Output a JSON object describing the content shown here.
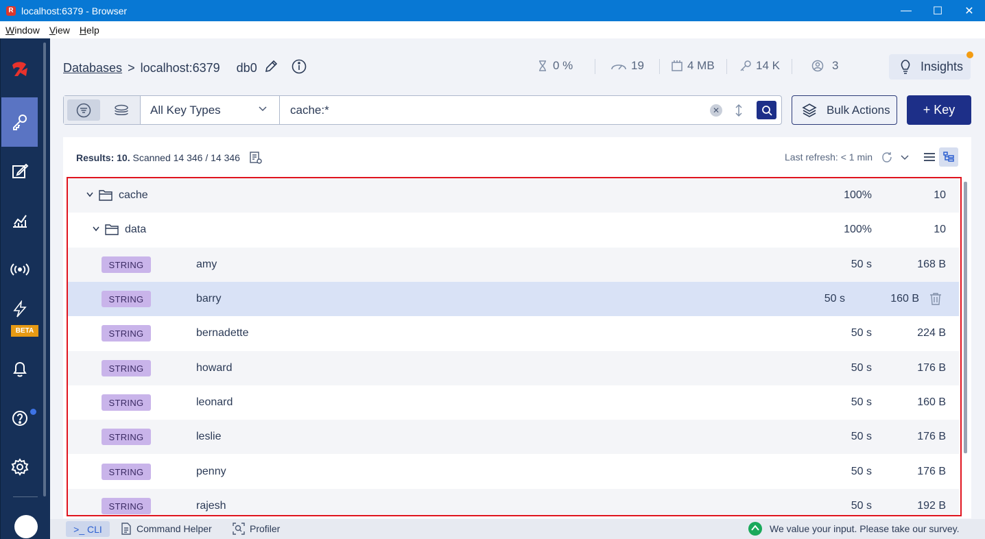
{
  "window": {
    "title": "localhost:6379 - Browser",
    "app_icon": "R"
  },
  "menu": [
    "Window",
    "View",
    "Help"
  ],
  "sidebar": {
    "beta_label": "BETA"
  },
  "breadcrumb": {
    "databases": "Databases",
    "separator": ">",
    "host": "localhost:6379",
    "db": "db0"
  },
  "stats": {
    "cpu": "0 %",
    "ops": "19",
    "memory": "4 MB",
    "keys": "14 K",
    "clients": "3"
  },
  "insights_label": "Insights",
  "filter": {
    "key_type": "All Key Types",
    "search_value": "cache:*"
  },
  "buttons": {
    "bulk_actions": "Bulk Actions",
    "add_key": "+ Key"
  },
  "results": {
    "label": "Results:",
    "count": "10.",
    "scanned": "Scanned 14 346 / 14 346",
    "last_refresh": "Last refresh: < 1 min"
  },
  "tree": {
    "folders": [
      {
        "name": "cache",
        "percent": "100%",
        "count": "10"
      },
      {
        "name": "data",
        "percent": "100%",
        "count": "10"
      }
    ],
    "keys": [
      {
        "type": "STRING",
        "name": "amy",
        "ttl": "50 s",
        "size": "168 B"
      },
      {
        "type": "STRING",
        "name": "barry",
        "ttl": "50 s",
        "size": "160 B"
      },
      {
        "type": "STRING",
        "name": "bernadette",
        "ttl": "50 s",
        "size": "224 B"
      },
      {
        "type": "STRING",
        "name": "howard",
        "ttl": "50 s",
        "size": "176 B"
      },
      {
        "type": "STRING",
        "name": "leonard",
        "ttl": "50 s",
        "size": "160 B"
      },
      {
        "type": "STRING",
        "name": "leslie",
        "ttl": "50 s",
        "size": "176 B"
      },
      {
        "type": "STRING",
        "name": "penny",
        "ttl": "50 s",
        "size": "176 B"
      },
      {
        "type": "STRING",
        "name": "rajesh",
        "ttl": "50 s",
        "size": "192 B"
      }
    ]
  },
  "bottom": {
    "cli": ">_ CLI",
    "command_helper": "Command Helper",
    "profiler": "Profiler",
    "survey": "We value your input. Please take our survey."
  },
  "colors": {
    "accent": "#1d2f88",
    "sidebar": "#163058",
    "badge": "#c9b4ea",
    "highlight": "#e0141e"
  }
}
